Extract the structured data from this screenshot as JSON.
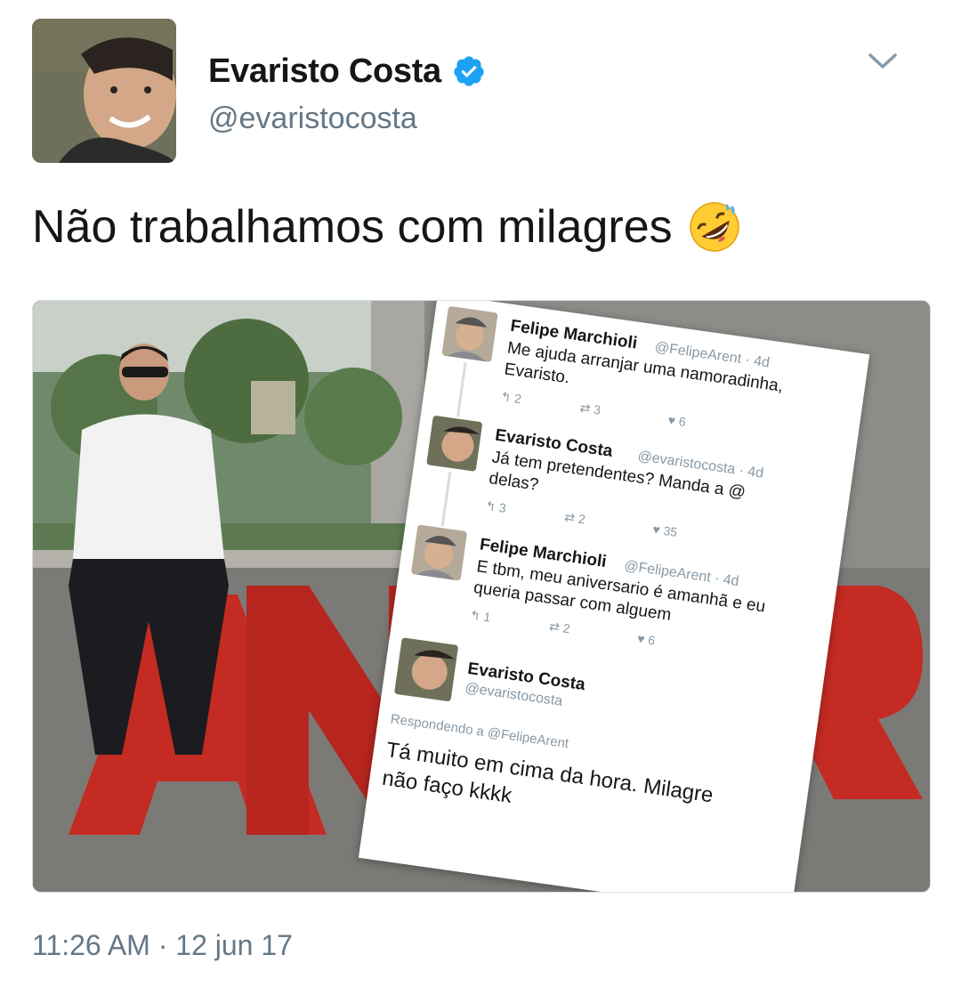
{
  "user": {
    "name": "Evaristo Costa",
    "handle": "@evaristocosta",
    "verified": true,
    "avatar_icon": "profile-photo"
  },
  "tweet": {
    "text": "Não trabalhamos com milagres",
    "emoji": "rolling-on-floor-laughing-emoji",
    "timestamp": "11:26 AM · 12 jun 17"
  },
  "embedded": {
    "t1": {
      "name": "Felipe Marchioli",
      "handle": "@FelipeArent · 4d",
      "text1": "Me ajuda arranjar uma namoradinha,",
      "text2": "Evaristo.",
      "replies": "2",
      "retweets": "3",
      "likes": "6"
    },
    "t2": {
      "name": "Evaristo Costa",
      "handle": "@evaristocosta · 4d",
      "text1": "Já tem pretendentes? Manda a @",
      "text2": "delas?",
      "replies": "3",
      "retweets": "2",
      "likes": "35"
    },
    "t3": {
      "name": "Felipe Marchioli",
      "handle": "@FelipeArent · 4d",
      "text1": "E tbm, meu aniversario é amanhã e eu",
      "text2": "queria passar com alguem",
      "replies": "1",
      "retweets": "2",
      "likes": "6"
    },
    "t4": {
      "name": "Evaristo Costa",
      "handle": "@evaristocosta",
      "replying": "Respondendo a @FelipeArent",
      "text1": "Tá muito em cima da hora. Milagre",
      "text2": "não faço kkkk"
    }
  },
  "colors": {
    "verified": "#1da1f2",
    "muted": "#657786",
    "sign_red": "#c42b22"
  }
}
